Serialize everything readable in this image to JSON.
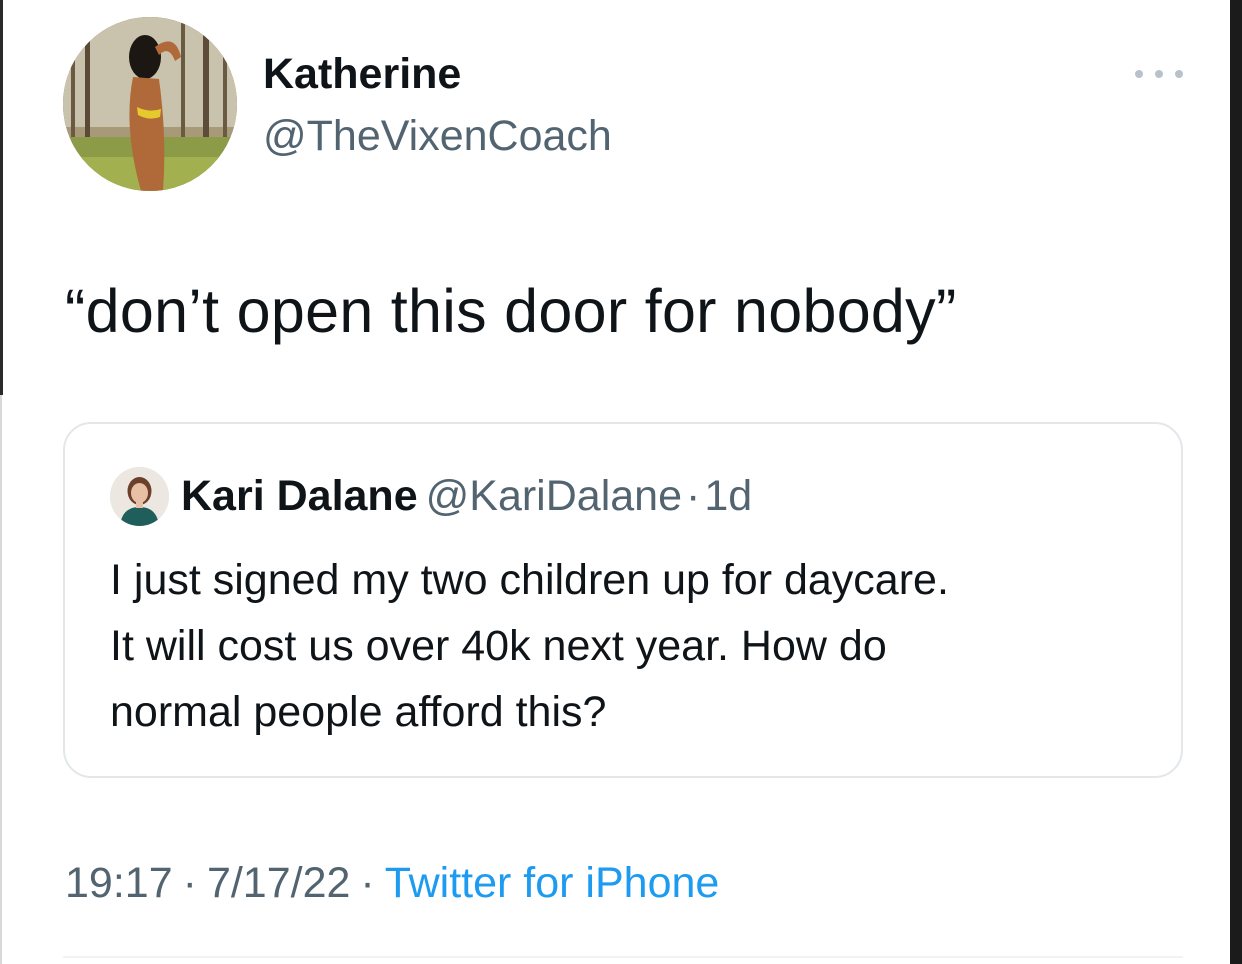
{
  "tweet": {
    "author_name": "Katherine",
    "author_handle": "@TheVixenCoach",
    "more_icon": "more-horizontal-icon",
    "text": "“don’t open this door for nobody”",
    "time": "19:17",
    "date": "7/17/22",
    "source": "Twitter for iPhone",
    "separator": "·"
  },
  "quoted_tweet": {
    "author_name": "Kari Dalane",
    "author_handle": "@KariDalane",
    "separator": "·",
    "age": "1d",
    "lines": [
      "I just signed my two children up for daycare.",
      "It will cost us over 40k next year.  How do",
      "normal people afford this?"
    ]
  },
  "colors": {
    "text_primary": "#0f1419",
    "text_secondary": "#536471",
    "link": "#1d9bf0",
    "border": "#e3e7ea"
  }
}
